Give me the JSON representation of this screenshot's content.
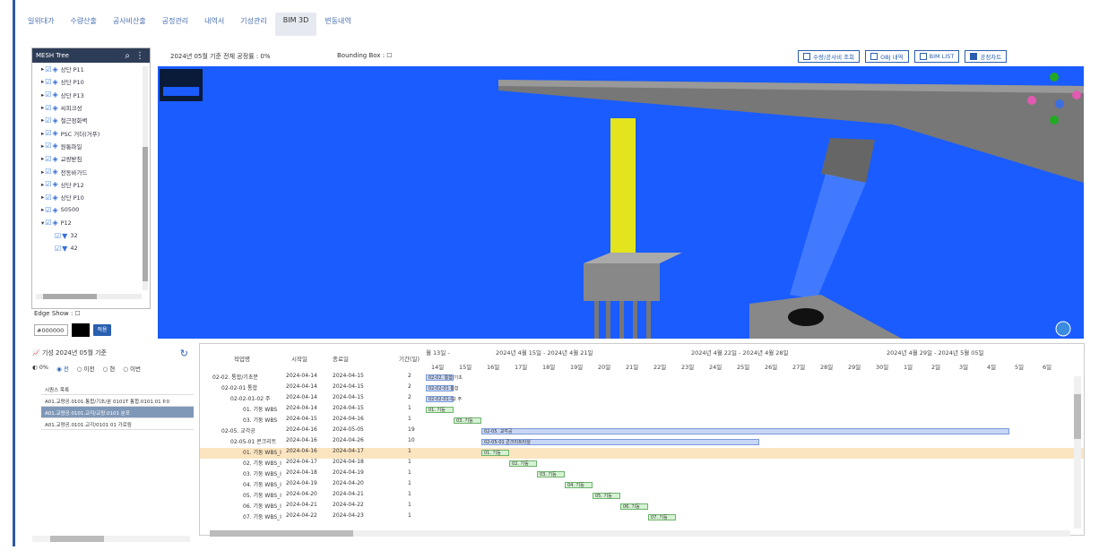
{
  "tabs": [
    "일위대가",
    "수량산출",
    "공사비산출",
    "공정관리",
    "내역서",
    "기성관리",
    "BIM 3D",
    "변동내역"
  ],
  "mesh_tree": {
    "title": "MESH Tree",
    "items": [
      "상단 P11",
      "상단 P10",
      "상단 P13",
      "씨피크성",
      "철근정화벽",
      "PSC 거더(거푸)",
      "원통파일",
      "교량받침",
      "전동바가드",
      "상단 P12",
      "상단 P10",
      "S0500",
      "P12",
      "32",
      "42"
    ]
  },
  "edge_show": {
    "label": "Edge Show :",
    "color_value": "#000000",
    "apply": "적용"
  },
  "viewer": {
    "status": "2024년 05월 기준 전체 공정률 : 0%",
    "bounding_box": "Bounding Box :"
  },
  "toolbar": [
    "수량/공사비 조회",
    "OBJ 내역",
    "BIM LIST",
    "공정차트"
  ],
  "gantt_panel": {
    "title": "기성 2024년 05월 기준",
    "radios": [
      "0%",
      "전",
      "이전",
      "현",
      "이번"
    ]
  },
  "sel_list": [
    "시퀀스 목록",
    "A01.교량공.0101.통합/기초/분 0101T 통합.0101.01 P.0",
    "A01.교량공.0101.교각/교량.0101 분포",
    "A01.교량공.0101.교각/0101 01 가로림"
  ],
  "gantt": {
    "cols": [
      "작업명",
      "시작일",
      "종료일",
      "기간(일)"
    ],
    "week_groups": [
      "월 13일 -",
      "2024년 4월 15일 - 2024년 4월 21일",
      "2024년 4월 22일 - 2024년 4월 28일",
      "2024년 4월 29일 - 2024년 5월 05일"
    ],
    "days": [
      "14일",
      "15일",
      "16일",
      "17일",
      "18일",
      "19일",
      "20일",
      "21일",
      "22일",
      "23일",
      "24일",
      "25일",
      "26일",
      "27일",
      "28일",
      "29일",
      "30일",
      "1일",
      "2일",
      "3일",
      "4일",
      "5일",
      "6일"
    ],
    "rows": [
      {
        "name": "02-02. 통합/기초분",
        "start": "2024-04-14",
        "end": "2024-04-15",
        "dur": "2"
      },
      {
        "name": "02-02-01 통합",
        "start": "2024-04-14",
        "end": "2024-04-15",
        "dur": "2"
      },
      {
        "name": "02-02-01-02 주",
        "start": "2024-04-14",
        "end": "2024-04-15",
        "dur": "2"
      },
      {
        "name": "01. 기둥 WBS",
        "start": "2024-04-14",
        "end": "2024-04-15",
        "dur": "1"
      },
      {
        "name": "03. 기둥 WBS",
        "start": "2024-04-15",
        "end": "2024-04-16",
        "dur": "1"
      },
      {
        "name": "02-05. 교각공",
        "start": "2024-04-16",
        "end": "2024-05-05",
        "dur": "19"
      },
      {
        "name": "02-05-01 콘크리트",
        "start": "2024-04-16",
        "end": "2024-04-26",
        "dur": "10"
      },
      {
        "name": "01. 기둥 WBS_I",
        "start": "2024-04-16",
        "end": "2024-04-17",
        "dur": "1"
      },
      {
        "name": "02. 기둥 WBS_I",
        "start": "2024-04-17",
        "end": "2024-04-18",
        "dur": "1"
      },
      {
        "name": "03. 기둥 WBS_I",
        "start": "2024-04-18",
        "end": "2024-04-19",
        "dur": "1"
      },
      {
        "name": "04. 기둥 WBS_I",
        "start": "2024-04-19",
        "end": "2024-04-20",
        "dur": "1"
      },
      {
        "name": "05. 기둥 WBS_I",
        "start": "2024-04-20",
        "end": "2024-04-21",
        "dur": "1"
      },
      {
        "name": "06. 기둥 WBS_I",
        "start": "2024-04-21",
        "end": "2024-04-22",
        "dur": "1"
      },
      {
        "name": "07. 기둥 WBS_I",
        "start": "2024-04-22",
        "end": "2024-04-23",
        "dur": "1"
      }
    ],
    "bar_labels": [
      "02-02. 통합/기초",
      "02-02-01 통합",
      "02-02-01-02 주",
      "01. 기둥",
      "03. 기둥",
      "02-05. 교각공",
      "02-05-01 콘크리트타설",
      "01. 기둥",
      "02. 기둥",
      "03. 기둥",
      "04. 기둥",
      "05. 기둥",
      "06. 기둥",
      "07. 기둥"
    ]
  }
}
